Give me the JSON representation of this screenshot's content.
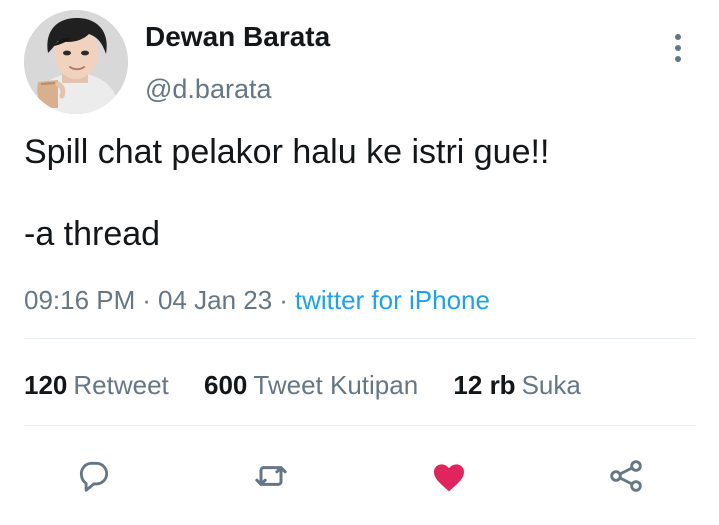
{
  "user": {
    "display_name": "Dewan Barata",
    "handle": "@d.barata",
    "avatar_icon": "profile-photo"
  },
  "tweet": {
    "lines": [
      "Spill chat pelakor halu ke istri gue!!",
      "-a thread"
    ],
    "time": "09:16 PM",
    "separator": "·",
    "date": "04 Jan 23",
    "source": "twitter for iPhone"
  },
  "stats": [
    {
      "count": "120",
      "label": "Retweet"
    },
    {
      "count": "600",
      "label": "Tweet Kutipan"
    },
    {
      "count": "12 rb",
      "label": "Suka"
    }
  ],
  "actions": [
    {
      "icon": "reply-icon"
    },
    {
      "icon": "retweet-icon"
    },
    {
      "icon": "heart-icon"
    },
    {
      "icon": "share-icon"
    }
  ],
  "colors": {
    "text_primary": "#14171a",
    "text_secondary": "#657786",
    "link": "#1da1f2",
    "divider": "#e6ecf0",
    "heart_liked": "#e0245e"
  }
}
